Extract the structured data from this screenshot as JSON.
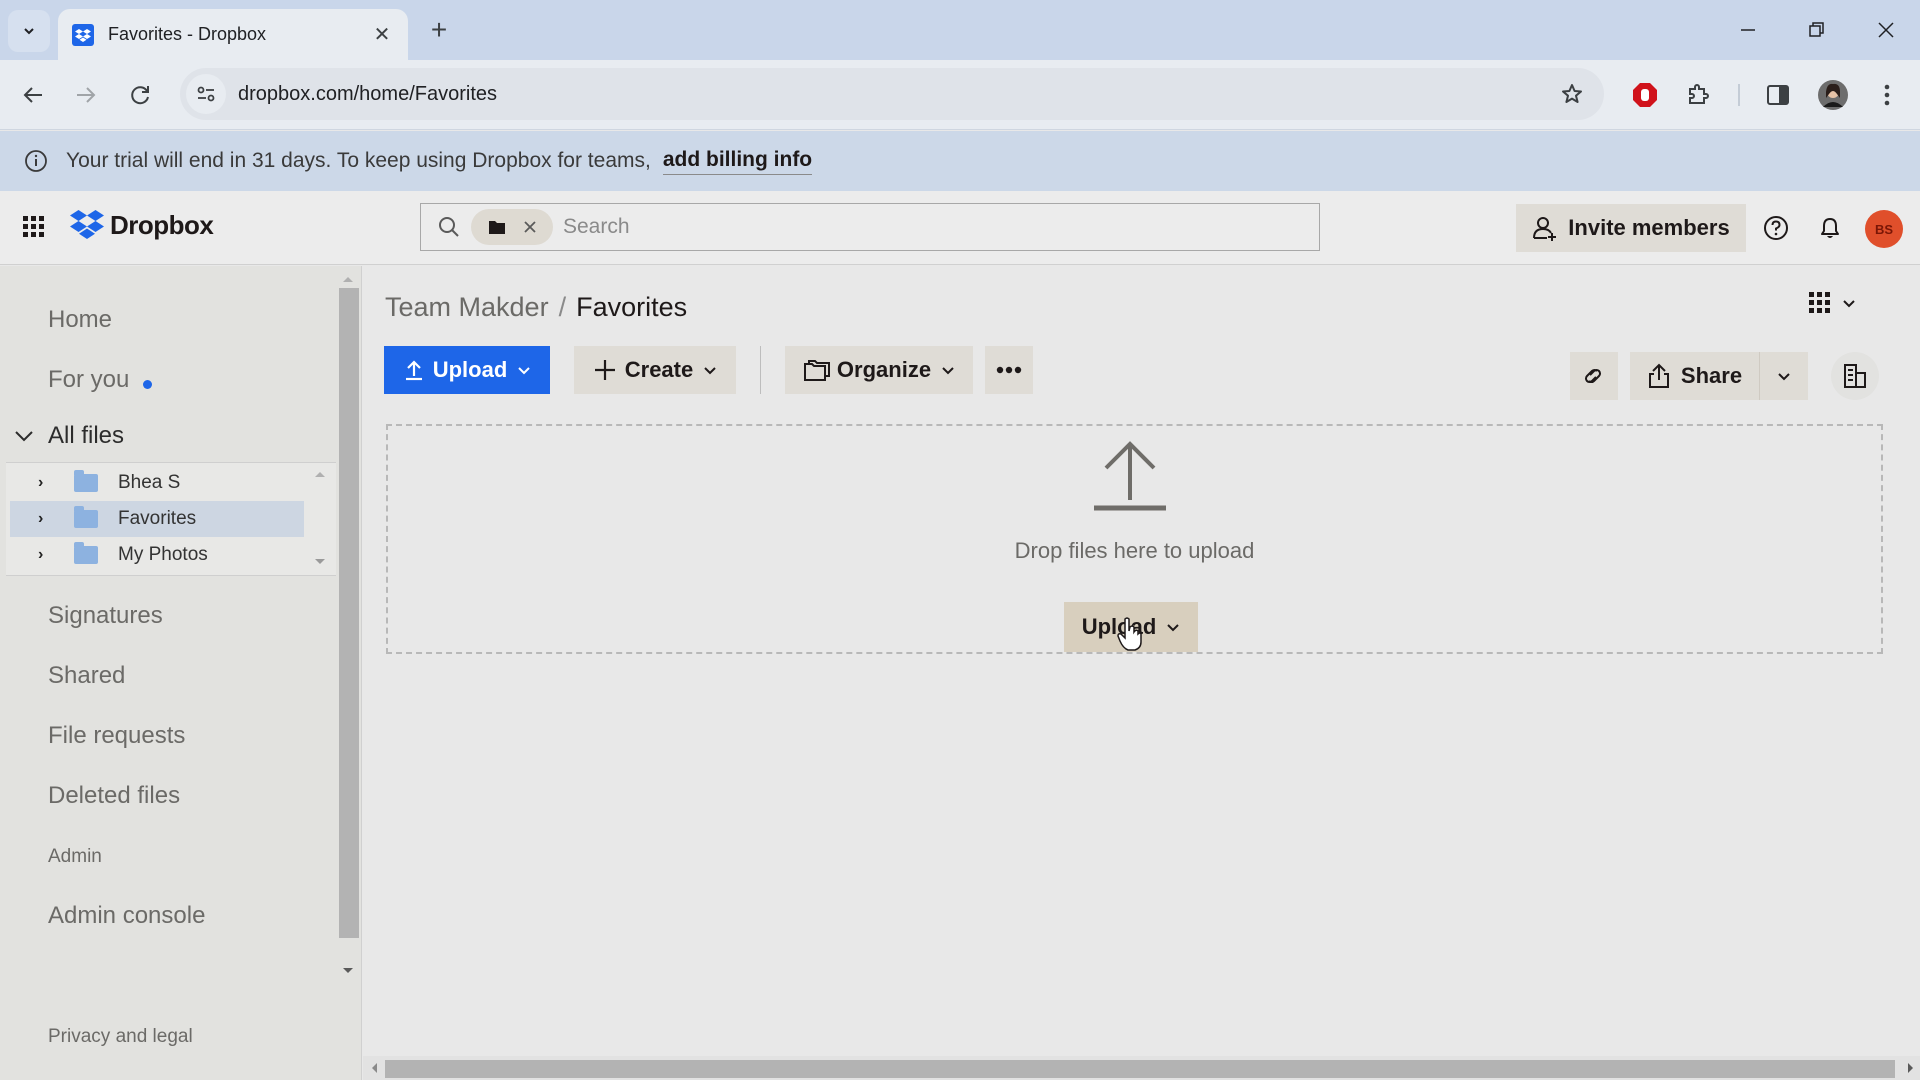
{
  "browser": {
    "tab_title": "Favorites - Dropbox",
    "url": "dropbox.com/home/Favorites",
    "new_tab_symbol": "+",
    "tab_close_symbol": "✕"
  },
  "banner": {
    "message": "Your trial will end in 31 days. To keep using Dropbox for teams,",
    "link": "add billing info"
  },
  "header": {
    "logo_text": "Dropbox",
    "search_placeholder": "Search",
    "invite_label": "Invite members",
    "avatar_initials": "BS",
    "avatar_color": "#e04f2b"
  },
  "sidebar": {
    "items": [
      {
        "label": "Home"
      },
      {
        "label": "For you",
        "has_dot": true
      },
      {
        "label": "All files",
        "expanded": true
      },
      {
        "label": "Signatures"
      },
      {
        "label": "Shared"
      },
      {
        "label": "File requests"
      },
      {
        "label": "Deleted files"
      },
      {
        "label": "Admin"
      },
      {
        "label": "Admin console"
      }
    ],
    "tree": [
      {
        "label": "Bhea S",
        "selected": false
      },
      {
        "label": "Favorites",
        "selected": true
      },
      {
        "label": "My Photos",
        "selected": false
      }
    ],
    "footer": "Privacy and legal"
  },
  "main": {
    "breadcrumb": {
      "parent": "Team Makder",
      "separator": "/",
      "current": "Favorites"
    },
    "toolbar": {
      "upload": "Upload",
      "create": "Create",
      "organize": "Organize",
      "share": "Share"
    },
    "dropzone": {
      "text": "Drop files here to upload",
      "button": "Upload"
    }
  },
  "colors": {
    "accent": "#1e66e8",
    "banner_bg": "#ccd8e8",
    "secondary_button": "#dfdcd6"
  }
}
